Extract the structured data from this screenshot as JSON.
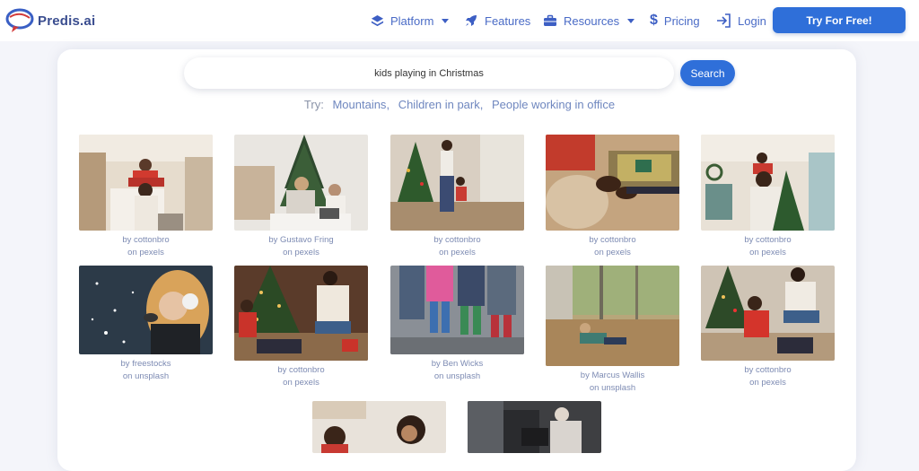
{
  "brand": {
    "name": "Predis.ai",
    "colors": {
      "primary": "#2f6fd9",
      "nav_text": "#4a6bc6"
    }
  },
  "nav": {
    "items": [
      {
        "label": "Platform",
        "icon": "layers-icon",
        "dropdown": true
      },
      {
        "label": "Features",
        "icon": "rocket-icon",
        "dropdown": false
      },
      {
        "label": "Resources",
        "icon": "briefcase-icon",
        "dropdown": true
      },
      {
        "label": "Pricing",
        "icon": "dollar-icon",
        "dropdown": false
      },
      {
        "label": "Login",
        "icon": "login-icon",
        "dropdown": false
      }
    ],
    "cta_label": "Try For Free!"
  },
  "search": {
    "value": "kids playing in Christmas",
    "button_label": "Search",
    "try_label": "Try:",
    "suggestions": [
      "Mountains",
      "Children in park",
      "People working in office"
    ]
  },
  "results": [
    {
      "by": "by cottonbro",
      "source": "on pexels"
    },
    {
      "by": "by Gustavo Fring",
      "source": "on pexels"
    },
    {
      "by": "by cottonbro",
      "source": "on pexels"
    },
    {
      "by": "by cottonbro",
      "source": "on pexels"
    },
    {
      "by": "by cottonbro",
      "source": "on pexels"
    },
    {
      "by": "by freestocks",
      "source": "on unsplash"
    },
    {
      "by": "by cottonbro",
      "source": "on pexels"
    },
    {
      "by": "by Ben Wicks",
      "source": "on unsplash"
    },
    {
      "by": "by Marcus Wallis",
      "source": "on unsplash"
    },
    {
      "by": "by cottonbro",
      "source": "on pexels"
    }
  ]
}
